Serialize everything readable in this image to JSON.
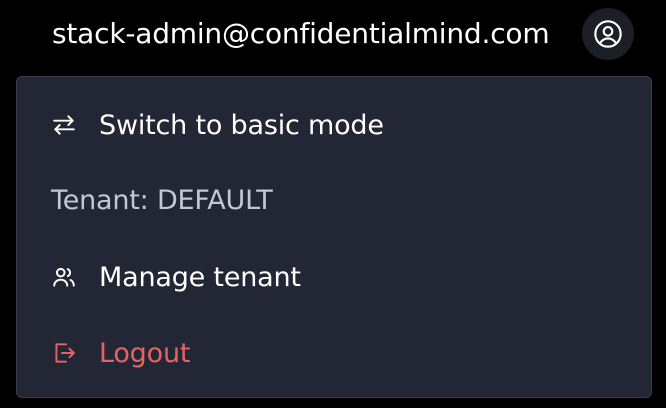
{
  "header": {
    "user_email": "stack-admin@confidentialmind.com",
    "avatar_icon": "user-circle-icon"
  },
  "menu": {
    "switch_mode": {
      "label": "Switch to basic mode",
      "icon": "swap-arrows-icon"
    },
    "tenant_label": "Tenant: DEFAULT",
    "manage_tenant": {
      "label": "Manage tenant",
      "icon": "users-icon"
    },
    "logout": {
      "label": "Logout",
      "icon": "logout-icon",
      "color": "#e46464"
    }
  },
  "colors": {
    "background": "#000000",
    "menu_background": "#232634",
    "menu_border": "#3a3e4c",
    "text_primary": "#ffffff",
    "text_secondary": "#c4c7d2",
    "danger": "#e46464"
  }
}
